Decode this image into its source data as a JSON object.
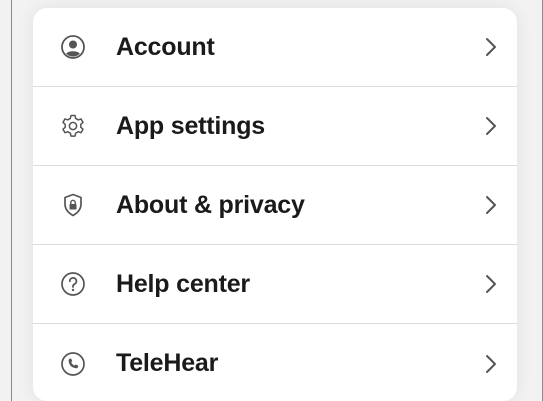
{
  "menu": {
    "items": [
      {
        "label": "Account",
        "icon": "account-icon"
      },
      {
        "label": "App settings",
        "icon": "gear-icon"
      },
      {
        "label": "About & privacy",
        "icon": "shield-lock-icon"
      },
      {
        "label": "Help center",
        "icon": "help-icon"
      },
      {
        "label": "TeleHear",
        "icon": "phone-icon"
      }
    ]
  },
  "colors": {
    "background": "#f2f2f2",
    "card": "#ffffff",
    "text": "#1a1a1a",
    "icon": "#555555",
    "divider": "#dcdcdc"
  }
}
